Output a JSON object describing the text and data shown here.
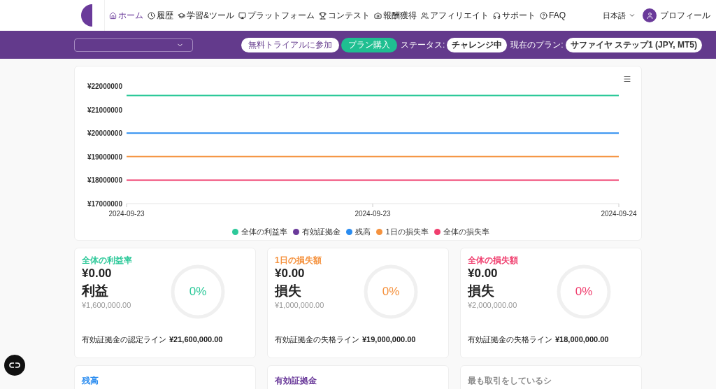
{
  "nav": {
    "items": [
      {
        "label": "ホーム",
        "selected": true
      },
      {
        "label": "履歴",
        "selected": false
      },
      {
        "label": "学習&ツール",
        "selected": false
      },
      {
        "label": "プラットフォーム",
        "selected": false
      },
      {
        "label": "コンテスト",
        "selected": false
      },
      {
        "label": "報酬獲得",
        "selected": false
      },
      {
        "label": "アフィリエイト",
        "selected": false
      },
      {
        "label": "サポート",
        "selected": false
      },
      {
        "label": "FAQ",
        "selected": false
      }
    ],
    "language": "日本語",
    "profile": "プロフィール"
  },
  "toolbar": {
    "trial_button": "無料トライアルに参加",
    "buy_button": "プラン購入",
    "status_label": "ステータス:",
    "status": "チャレンジ中",
    "plan_label": "現在のプラン:",
    "plan": "サファイヤ ステップ1 (JPY, MT5)"
  },
  "chart_data": {
    "type": "line",
    "legend": "bottom",
    "categories": [
      "2024-09-23",
      "2024-09-23",
      "2024-09-24"
    ],
    "ylim": [
      17000000,
      22000000
    ],
    "yticks": [
      {
        "value": 17000000,
        "label": "¥17000000"
      },
      {
        "value": 18000000,
        "label": "¥18000000"
      },
      {
        "value": 19000000,
        "label": "¥19000000"
      },
      {
        "value": 20000000,
        "label": "¥20000000"
      },
      {
        "value": 21000000,
        "label": "¥21000000"
      },
      {
        "value": 22000000,
        "label": "¥22000000"
      }
    ],
    "series": [
      {
        "name": "全体の利益率",
        "color": "#2ec99a",
        "values": [
          21600000,
          21600000,
          21600000
        ]
      },
      {
        "name": "有効証拠金",
        "color": "#6a3a9a",
        "values": [
          null,
          null,
          null
        ]
      },
      {
        "name": "残高",
        "color": "#2a8cf0",
        "values": [
          20000000,
          20000000,
          20000000
        ]
      },
      {
        "name": "1日の損失率",
        "color": "#f5923e",
        "values": [
          19000000,
          19000000,
          19000000
        ]
      },
      {
        "name": "全体の損失率",
        "color": "#f03e6e",
        "values": [
          18000000,
          18000000,
          18000000
        ]
      }
    ]
  },
  "stat_cards": [
    {
      "label": "全体の利益率",
      "color": "#2ec99a",
      "amount": "¥0.00",
      "kind_text": "利益",
      "target": "¥1,600,000.00",
      "percent": "0%",
      "level": 0,
      "line_label": "有効証拠金の認定ライン",
      "line_value": "¥21,600,000.00"
    },
    {
      "label": "1日の損失額",
      "color": "#f5923e",
      "amount": "¥0.00",
      "kind_text": "損失",
      "target": "¥1,000,000.00",
      "percent": "0%",
      "level": 0,
      "line_label": "有効証拠金の失格ライン",
      "line_value": "¥19,000,000.00"
    },
    {
      "label": "全体の損失額",
      "color": "#f03e6e",
      "amount": "¥0.00",
      "kind_text": "損失",
      "target": "¥2,000,000.00",
      "percent": "0%",
      "level": 0,
      "line_label": "有効証拠金の失格ライン",
      "line_value": "¥18,000,000.00"
    }
  ],
  "bottom_cards": [
    {
      "label": "残高",
      "color": "#2a8cf0"
    },
    {
      "label": "有効証拠金",
      "color": "#6a3a9a"
    },
    {
      "label": "最も取引をしているシ",
      "color": "#8a8a8a"
    }
  ]
}
